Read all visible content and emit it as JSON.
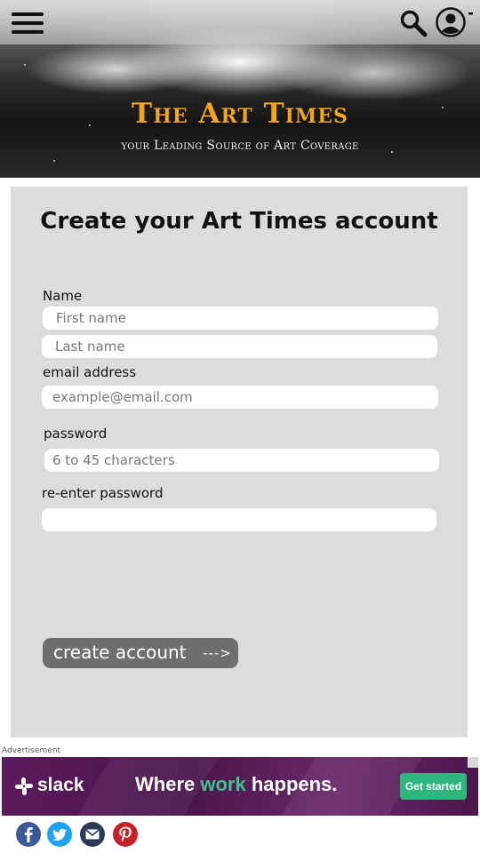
{
  "header": {
    "brand_title": "The Art Times",
    "brand_tagline": "your Leading Source of Art Coverage",
    "menu_icon": "hamburger-menu-icon",
    "search_icon": "search-icon",
    "account_icon": "user-avatar-icon"
  },
  "form": {
    "title": "Create your Art Times account",
    "name_label": "Name",
    "first_name_placeholder": "First name",
    "first_name_value": "",
    "last_name_placeholder": "Last name",
    "last_name_value": "",
    "email_label": "email address",
    "email_placeholder": "example@email.com",
    "email_value": "",
    "password_label": "password",
    "password_placeholder": "6 to 45 characters",
    "password_value": "",
    "reenter_label": "re-enter password",
    "reenter_placeholder": "",
    "reenter_value": "",
    "submit_label": "create account",
    "submit_arrow": "--->"
  },
  "ad": {
    "label": "Advertisement",
    "brand": "slack",
    "headline_part1": "Where ",
    "headline_highlight": "work",
    "headline_part2": " happens.",
    "cta": "Get started"
  },
  "share": {
    "icons": [
      "facebook-icon",
      "twitter-icon",
      "email-icon",
      "pinterest-icon"
    ]
  },
  "colors": {
    "brand_gold": "#f2a516",
    "panel_bg": "#dcdcdc",
    "button_bg": "#6e6e6e",
    "slack_purple": "#4a154b",
    "slack_green": "#2eb67d",
    "facebook_blue": "#3b5998",
    "twitter_blue": "#1da1f2",
    "email_navy": "#2b3a55",
    "pinterest_red": "#cb2027"
  }
}
